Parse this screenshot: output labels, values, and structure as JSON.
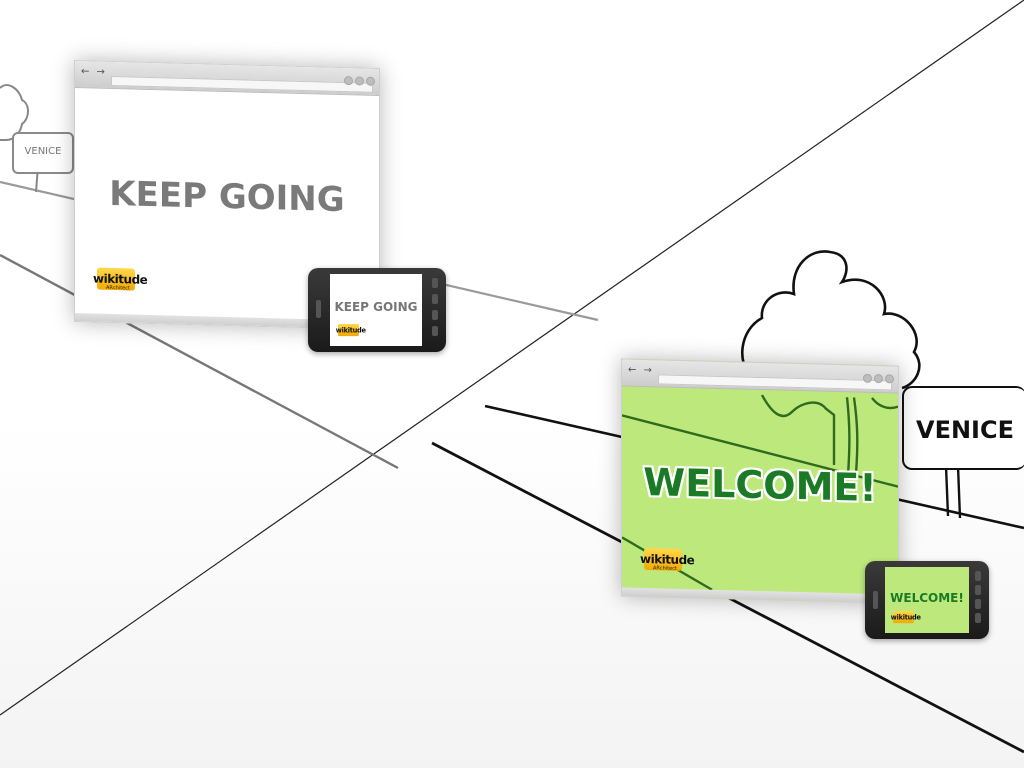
{
  "left_scene": {
    "sign_label": "VENICE",
    "browser_headline": "KEEP GOING",
    "phone_headline": "KEEP GOING",
    "browser_nav": "← →"
  },
  "right_scene": {
    "sign_label": "VENICE",
    "browser_headline": "WELCOME!",
    "phone_headline": "WELCOME!",
    "browser_nav": "← →"
  },
  "logo": {
    "name": "wikitude",
    "sub": "ARchitect"
  },
  "colors": {
    "green_screen": "#bde87c",
    "green_text": "#1a7a25",
    "gray_text": "#777777",
    "logo_yellow": "#f5b400"
  }
}
